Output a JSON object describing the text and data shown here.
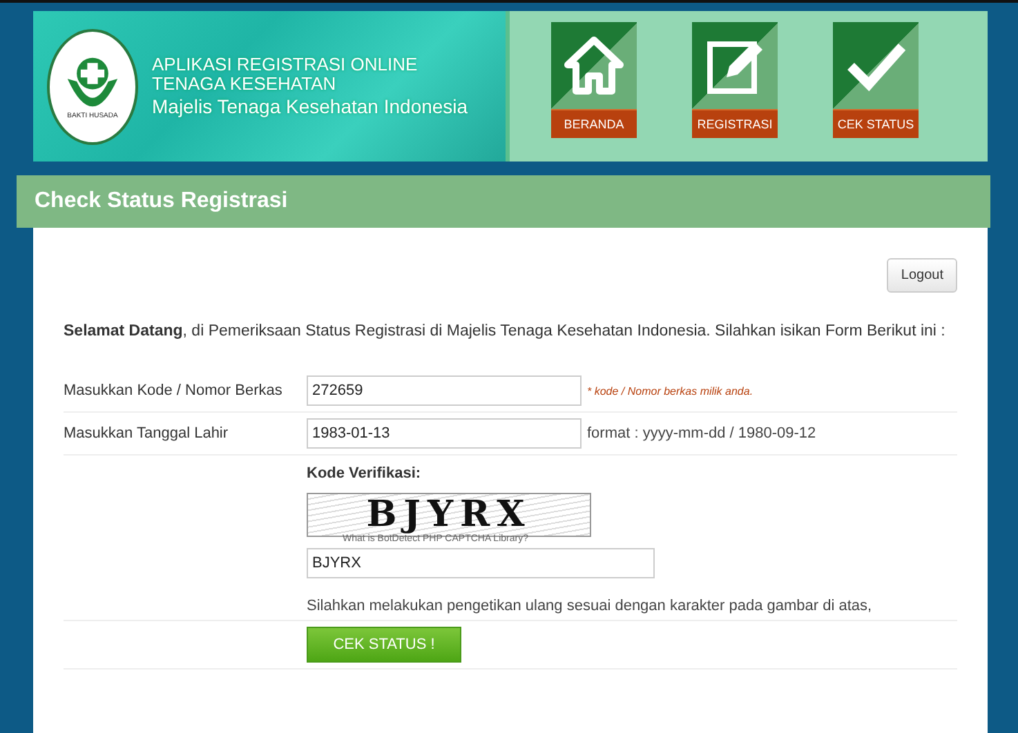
{
  "header": {
    "title_lines": [
      "APLIKASI REGISTRASI ONLINE",
      "TENAGA KESEHATAN"
    ],
    "subtitle": "Majelis Tenaga Kesehatan Indonesia",
    "logo_text": "BAKTI HUSADA",
    "nav": [
      {
        "kind": "home",
        "label": "BERANDA"
      },
      {
        "kind": "edit",
        "label": "REGISTRASI"
      },
      {
        "kind": "check",
        "label": "CEK STATUS"
      }
    ]
  },
  "page_title": "Check Status Registrasi",
  "logout": "Logout",
  "intro": "**Selamat Datang**, di Pemeriksaan Status Registrasi di Majelis Tenaga Kesehatan Indonesia. Silahkan isikan Form Berikut ini :",
  "fields": [
    {
      "label": "Masukkan Kode / Nomor Berkas",
      "value": "272659",
      "note": "* kode / Nomor berkas milik anda.",
      "kind": "warning"
    },
    {
      "label": "Masukkan Tanggal Lahir",
      "value": "1983-01-13",
      "note": "format : yyyy-mm-dd / 1980-09-12",
      "kind": "hint"
    }
  ],
  "captcha": {
    "label": "Kode Verifikasi:",
    "code": "BJYRX",
    "link": "What is BotDetect PHP CAPTCHA Library?",
    "value": "BJYRX",
    "instruction": "Silahkan melakukan pengetikan ulang sesuai dengan karakter pada gambar di atas,"
  },
  "submit": "CEK STATUS !"
}
